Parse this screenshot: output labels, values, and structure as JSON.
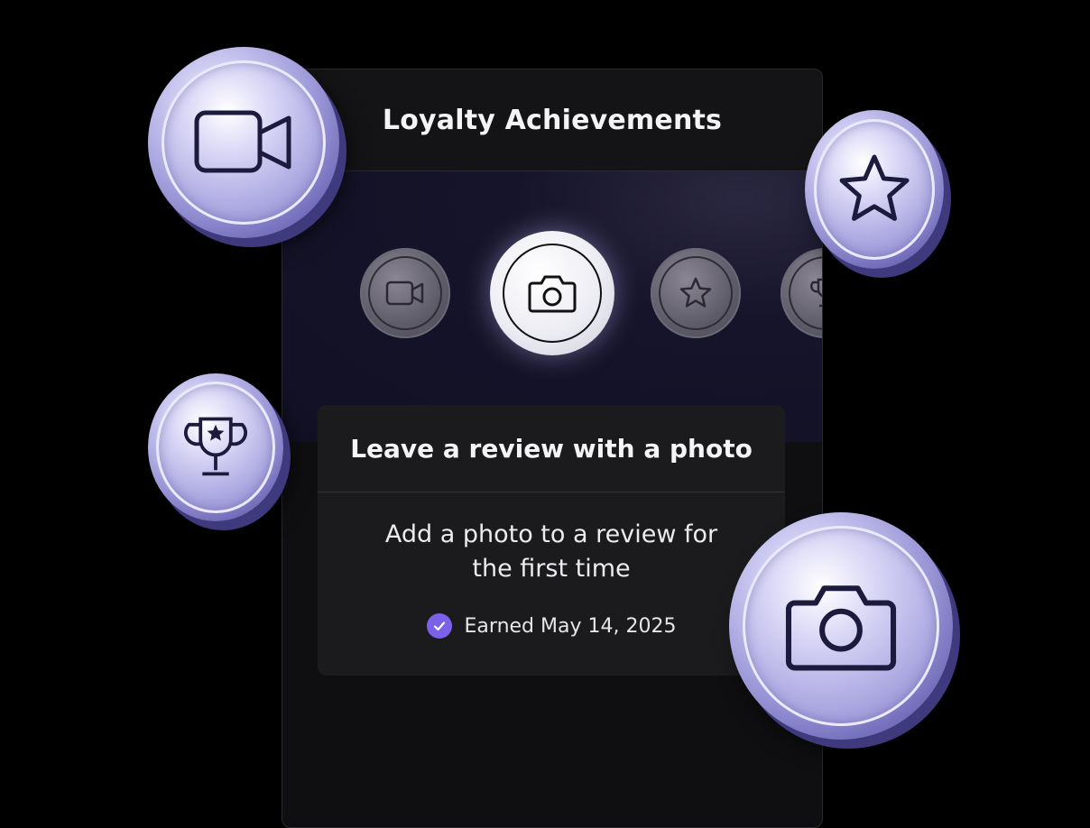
{
  "panel": {
    "title": "Loyalty Achievements"
  },
  "carousel": {
    "badges": [
      {
        "icon": "video-camera-icon",
        "state": "inactive"
      },
      {
        "icon": "camera-icon",
        "state": "active"
      },
      {
        "icon": "star-icon",
        "state": "inactive"
      },
      {
        "icon": "trophy-icon",
        "state": "inactive"
      }
    ]
  },
  "achievement": {
    "title": "Leave a review with a photo",
    "description": "Add a photo to a review for the first time",
    "earned": "Earned May 14, 2025"
  },
  "colors": {
    "accent": "#7b61e8",
    "coin": "#a9a5e0",
    "background": "#000000"
  },
  "floating_coins": [
    {
      "icon": "video-camera-icon"
    },
    {
      "icon": "star-icon"
    },
    {
      "icon": "trophy-icon"
    },
    {
      "icon": "camera-icon"
    }
  ]
}
